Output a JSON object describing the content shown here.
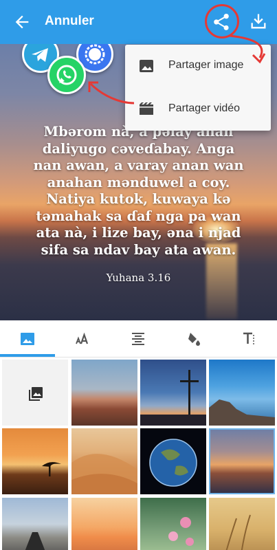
{
  "toolbar": {
    "title": "Annuler",
    "back_icon": "arrow-back-icon",
    "share_icon": "share-icon",
    "download_icon": "download-icon",
    "color": "#2f9ce8"
  },
  "share_menu": {
    "items": [
      {
        "label": "Partager image",
        "icon": "image-icon"
      },
      {
        "label": "Partager vidéo",
        "icon": "video-icon"
      }
    ]
  },
  "share_apps": [
    "telegram-icon",
    "signal-icon",
    "whatsapp-icon"
  ],
  "preview": {
    "verse_lines": [
      "Mbərom nà, a pəlay anan",
      "daliyugo cəveɗabay. Anga",
      "nan awan, a varay anan wan",
      "anahan mənduwel a coy.",
      "Natiya kutok, kuwaya kə",
      "təmahak sa ɗaf nga pa wan",
      "ata nà, i lize bay, əna i njad",
      "sifa sa ndav bay ata awan."
    ],
    "reference": "Yuhana 3.16"
  },
  "tabs": [
    {
      "icon": "image-icon",
      "active": true
    },
    {
      "icon": "text-size-icon",
      "active": false
    },
    {
      "icon": "align-center-icon",
      "active": false
    },
    {
      "icon": "paint-bucket-icon",
      "active": false
    },
    {
      "icon": "text-format-icon",
      "active": false
    }
  ],
  "gallery": {
    "picker_icon": "photo-library-icon",
    "images": [
      "desert-rocks",
      "cross-sunset",
      "rocky-shore-blue",
      "savanna-sunset-tree",
      "sand-dunes",
      "earth-globe",
      "ocean-sunset",
      "desert-road",
      "orange-horizon",
      "pink-flowers",
      "wheat-field"
    ],
    "selected_image": "ocean-sunset"
  }
}
